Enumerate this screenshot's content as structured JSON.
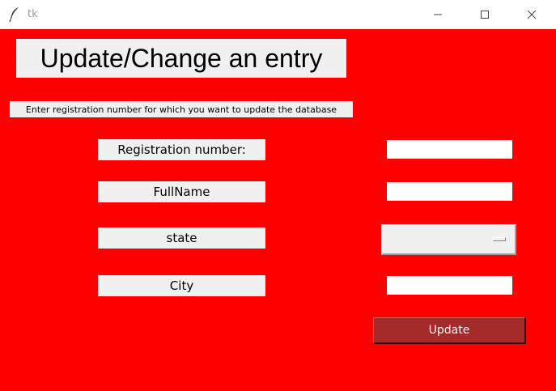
{
  "window": {
    "title": "tk",
    "icon": "feather-icon",
    "controls": [
      "minimize-icon",
      "maximize-icon",
      "close-icon"
    ]
  },
  "colors": {
    "background": "#ff0000",
    "label_bg": "#f0f0f0",
    "update_button_bg": "#a52a2a",
    "update_button_text": "#ffffff"
  },
  "form": {
    "heading": "Update/Change an entry",
    "instruction": "Enter registration number for which you want to update the database",
    "fields": {
      "registration": {
        "label": "Registration number:",
        "value": ""
      },
      "fullname": {
        "label": "FullName",
        "value": ""
      },
      "state": {
        "label": "state",
        "selected": ""
      },
      "city": {
        "label": "City",
        "value": ""
      }
    },
    "update_label": "Update"
  }
}
